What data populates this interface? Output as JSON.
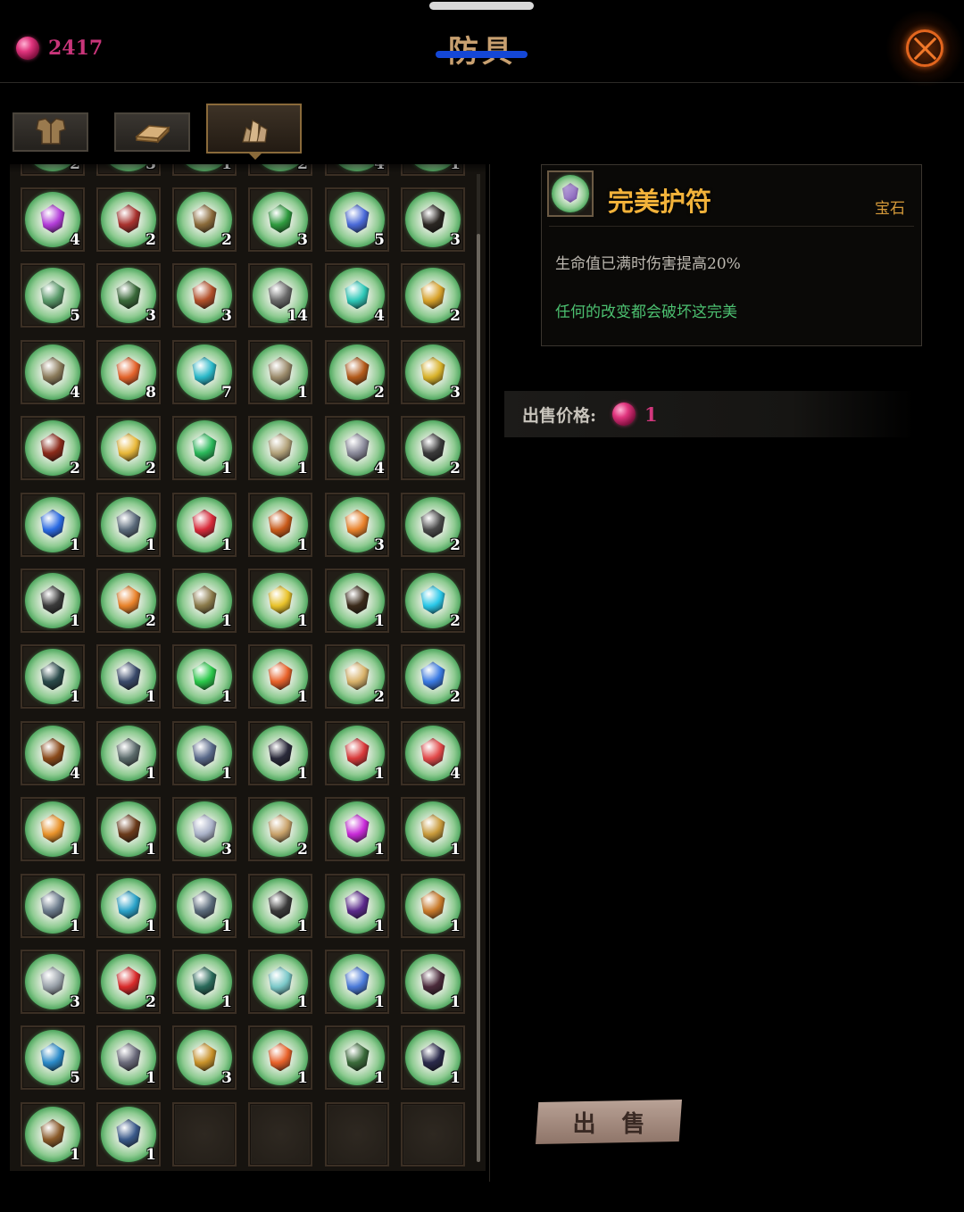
{
  "currency": {
    "value": "2417",
    "icon": "pink-gem-icon"
  },
  "header": {
    "title": "防具",
    "close_icon": "close-x-icon"
  },
  "tabs": [
    {
      "name": "tab-armor",
      "icon": "chest-armor-icon",
      "active": false
    },
    {
      "name": "tab-materials",
      "icon": "ingot-icon",
      "active": false
    },
    {
      "name": "tab-gems",
      "icon": "crystal-cluster-icon",
      "active": true
    }
  ],
  "partial_row_counts": [
    "2",
    "3",
    "1",
    "2",
    "4",
    "1"
  ],
  "inventory": [
    [
      {
        "c": "4",
        "col": "#b23cd8"
      },
      {
        "c": "2",
        "col": "#a8322e"
      },
      {
        "c": "2",
        "col": "#8a6a3a"
      },
      {
        "c": "3",
        "col": "#2e9a3e"
      },
      {
        "c": "5",
        "col": "#4a6ad8"
      },
      {
        "c": "3",
        "col": "#2a2622"
      }
    ],
    [
      {
        "c": "5",
        "col": "#5a9a6a"
      },
      {
        "c": "3",
        "col": "#3a6a3a"
      },
      {
        "c": "3",
        "col": "#b2502a"
      },
      {
        "c": "14",
        "col": "#6a6a6a"
      },
      {
        "c": "4",
        "col": "#2ec8b8"
      },
      {
        "c": "2",
        "col": "#d8a22a"
      }
    ],
    [
      {
        "c": "4",
        "col": "#8a7a5a"
      },
      {
        "c": "8",
        "col": "#e2622a"
      },
      {
        "c": "7",
        "col": "#2ab8c8"
      },
      {
        "c": "1",
        "col": "#9a8a6a"
      },
      {
        "c": "2",
        "col": "#b25a1a"
      },
      {
        "c": "3",
        "col": "#d8b22a"
      }
    ],
    [
      {
        "c": "2",
        "col": "#8a2a1a"
      },
      {
        "c": "2",
        "col": "#e8b83a"
      },
      {
        "c": "1",
        "col": "#2ab85a"
      },
      {
        "c": "1",
        "col": "#b2a27a"
      },
      {
        "c": "4",
        "col": "#8a8a9a"
      },
      {
        "c": "2",
        "col": "#3a3a3a"
      }
    ],
    [
      {
        "c": "1",
        "col": "#2a6ae2"
      },
      {
        "c": "1",
        "col": "#5a6a7a"
      },
      {
        "c": "1",
        "col": "#d82a3a"
      },
      {
        "c": "1",
        "col": "#c85a1a"
      },
      {
        "c": "3",
        "col": "#e8822a"
      },
      {
        "c": "2",
        "col": "#4a4a4a"
      }
    ],
    [
      {
        "c": "1",
        "col": "#3a3a3a"
      },
      {
        "c": "2",
        "col": "#e8822a"
      },
      {
        "c": "1",
        "col": "#8a7a4a"
      },
      {
        "c": "1",
        "col": "#e8c22a"
      },
      {
        "c": "1",
        "col": "#3a2a1a"
      },
      {
        "c": "2",
        "col": "#2ac8e8"
      }
    ],
    [
      {
        "c": "1",
        "col": "#2a4a4a"
      },
      {
        "c": "1",
        "col": "#3a4a6a"
      },
      {
        "c": "1",
        "col": "#2ac84a"
      },
      {
        "c": "1",
        "col": "#e8622a"
      },
      {
        "c": "2",
        "col": "#d8b26a"
      },
      {
        "c": "2",
        "col": "#3a7ae2"
      }
    ],
    [
      {
        "c": "4",
        "col": "#8a4a1a"
      },
      {
        "c": "1",
        "col": "#5a6a6a"
      },
      {
        "c": "1",
        "col": "#5a6a8a"
      },
      {
        "c": "1",
        "col": "#2a2a3a"
      },
      {
        "c": "1",
        "col": "#d83a3a"
      },
      {
        "c": "4",
        "col": "#e24a4a"
      }
    ],
    [
      {
        "c": "1",
        "col": "#e8922a"
      },
      {
        "c": "1",
        "col": "#6a3a1a"
      },
      {
        "c": "3",
        "col": "#aab2c8"
      },
      {
        "c": "2",
        "col": "#c8a26a"
      },
      {
        "c": "1",
        "col": "#c82ad8"
      },
      {
        "c": "1",
        "col": "#c89a3a"
      }
    ],
    [
      {
        "c": "1",
        "col": "#6a7a8a"
      },
      {
        "c": "1",
        "col": "#2aa2c8"
      },
      {
        "c": "1",
        "col": "#5a6a7a"
      },
      {
        "c": "1",
        "col": "#3a3a3a"
      },
      {
        "c": "1",
        "col": "#5a2a8a"
      },
      {
        "c": "1",
        "col": "#c87a2a"
      }
    ],
    [
      {
        "c": "3",
        "col": "#9aa2aa"
      },
      {
        "c": "2",
        "col": "#d82a2a"
      },
      {
        "c": "1",
        "col": "#2a6a5a"
      },
      {
        "c": "1",
        "col": "#7ac8c8"
      },
      {
        "c": "1",
        "col": "#4a7ad8"
      },
      {
        "c": "1",
        "col": "#4a2a3a"
      }
    ],
    [
      {
        "c": "5",
        "col": "#2a8ac8"
      },
      {
        "c": "1",
        "col": "#6a6a7a"
      },
      {
        "c": "3",
        "col": "#c8922a"
      },
      {
        "c": "1",
        "col": "#e8622a"
      },
      {
        "c": "1",
        "col": "#3a6a3a"
      },
      {
        "c": "1",
        "col": "#2a2a4a"
      }
    ],
    [
      {
        "c": "1",
        "col": "#8a5a2a"
      },
      {
        "c": "1",
        "col": "#3a5a8a"
      },
      null,
      null,
      null,
      null
    ]
  ],
  "detail": {
    "name": "完美护符",
    "type": "宝石",
    "effect": "生命值已满时伤害提高20%",
    "flavor": "任何的改变都会破坏这完美",
    "icon": "amulet-icon"
  },
  "sell": {
    "price_label": "出售价格:",
    "price_value": "1",
    "button_label": "出 售"
  },
  "colors": {
    "title": "#c8a070",
    "item_name": "#f2b23a",
    "flavor_text": "#4cc070",
    "currency": "#c9357a",
    "close_icon": "#e2651e"
  }
}
